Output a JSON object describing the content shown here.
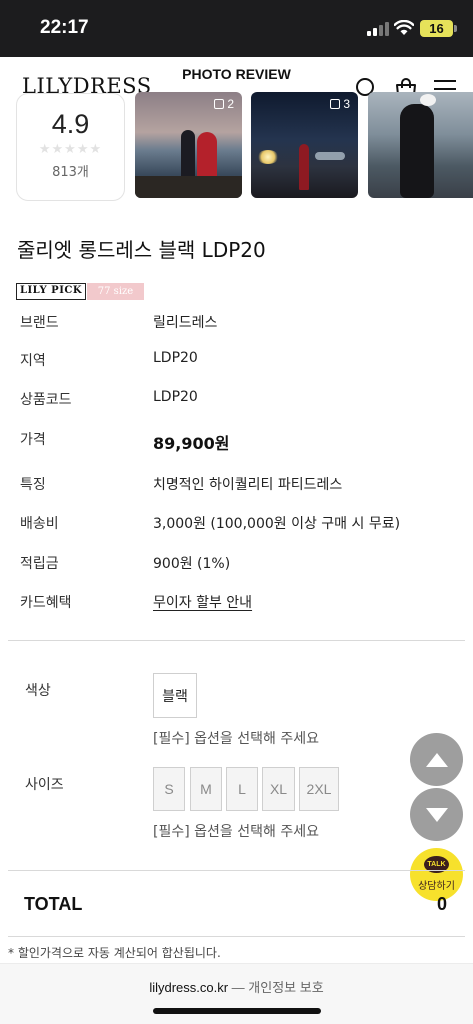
{
  "status_bar": {
    "time": "22:17",
    "battery": "16",
    "icons": [
      "signal-icon",
      "wifi-icon",
      "battery-icon"
    ]
  },
  "header": {
    "logo": "LILYDRESS",
    "section_title": "PHOTO REVIEW",
    "icons": [
      "search-icon",
      "shopping-bag-icon",
      "menu-icon"
    ]
  },
  "rating": {
    "score": "4.9",
    "stars": "★★★★★",
    "count": "813개"
  },
  "review_photos": [
    {
      "count": "2"
    },
    {
      "count": "3"
    },
    {
      "count": ""
    }
  ],
  "product": {
    "name": "줄리엣 롱드레스 블랙 LDP20",
    "badge_pick": "LILY PICK",
    "badge_size": "77 size",
    "info": [
      {
        "label": "브랜드",
        "value": "릴리드레스"
      },
      {
        "label": "지역",
        "value": "LDP20"
      },
      {
        "label": "상품코드",
        "value": "LDP20"
      },
      {
        "label": "가격",
        "value": "89,900원"
      },
      {
        "label": "특징",
        "value": "치명적인 하이퀄리티 파티드레스"
      },
      {
        "label": "배송비",
        "value": "3,000원 (100,000원 이상 구매 시 무료)"
      },
      {
        "label": "적립금",
        "value": "900원 (1%)"
      },
      {
        "label": "카드혜택",
        "value": "무이자 할부 안내"
      }
    ]
  },
  "options": {
    "color_label": "색상",
    "color_value": "블랙",
    "color_hint": "[필수] 옵션을 선택해 주세요",
    "size_label": "사이즈",
    "sizes": [
      "S",
      "M",
      "L",
      "XL",
      "2XL"
    ],
    "size_hint": "[필수] 옵션을 선택해 주세요"
  },
  "floating": {
    "talk_bubble": "TALK",
    "talk_label": "상담하기",
    "icons": [
      "arrow-up-icon",
      "arrow-down-icon",
      "kakao-talk-icon"
    ]
  },
  "total": {
    "label": "TOTAL",
    "value": "0"
  },
  "notice": "* 할인가격으로 자동 계산되어 합산됩니다.",
  "browser": {
    "domain": "lilydress.co.kr",
    "separator": " — ",
    "privacy": "개인정보 보호"
  }
}
